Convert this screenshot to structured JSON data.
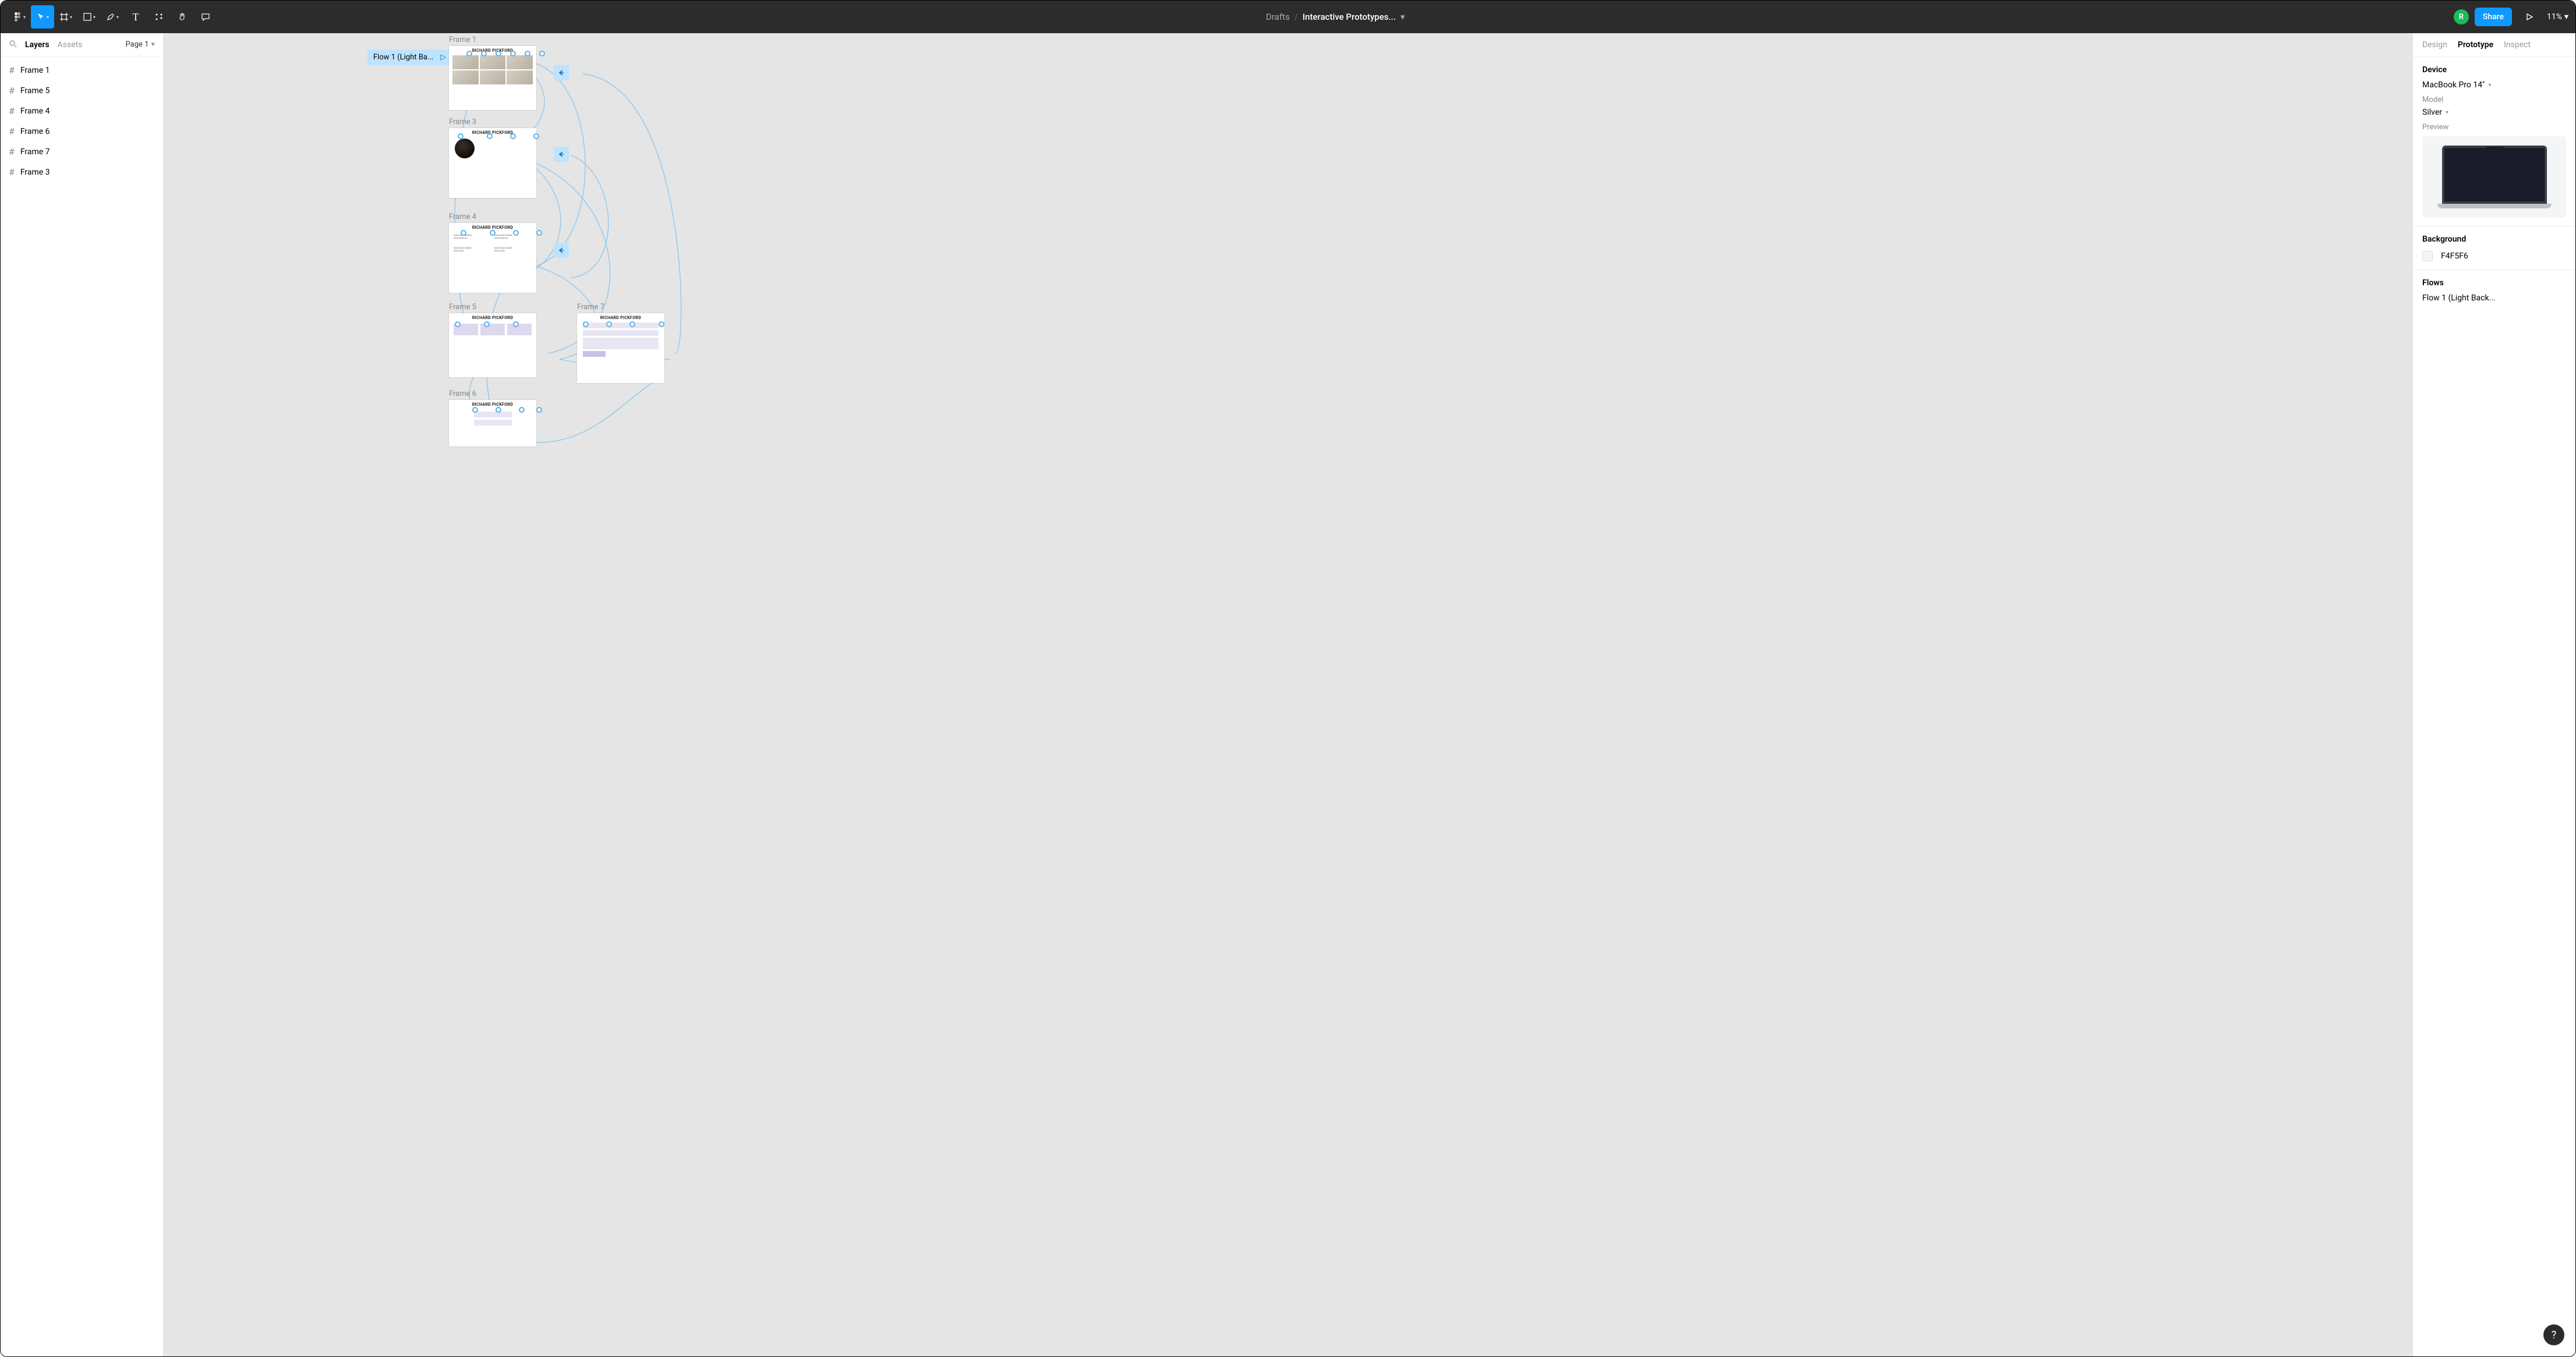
{
  "toolbar": {
    "breadcrumb_root": "Drafts",
    "title": "Interactive Prototypes...",
    "share_label": "Share",
    "zoom": "11%",
    "avatar_initial": "R"
  },
  "left": {
    "tab_layers": "Layers",
    "tab_assets": "Assets",
    "page": "Page 1",
    "layers": [
      "Frame 1",
      "Frame 5",
      "Frame 4",
      "Frame 6",
      "Frame 7",
      "Frame 3"
    ]
  },
  "canvas": {
    "flow_tag": "Flow 1 (Light Ba...",
    "frames": {
      "f1": {
        "label": "Frame 1",
        "heading": "RICHARD PICKFORD"
      },
      "f3": {
        "label": "Frame 3",
        "heading": "RICHARD PICKFORD"
      },
      "f4": {
        "label": "Frame 4",
        "heading": "RICHARD PICKFORD"
      },
      "f5": {
        "label": "Frame 5",
        "heading": "RICHARD PICKFORD"
      },
      "f7": {
        "label": "Frame 7",
        "heading": "RICHARD PICKFORD"
      },
      "f6": {
        "label": "Frame 6",
        "heading": "RICHARD PICKFORD"
      }
    }
  },
  "right": {
    "tab_design": "Design",
    "tab_prototype": "Prototype",
    "tab_inspect": "Inspect",
    "device_title": "Device",
    "device_value": "MacBook Pro 14\"",
    "model_label": "Model",
    "model_value": "Silver",
    "preview_label": "Preview",
    "background_title": "Background",
    "background_value": "F4F5F6",
    "flows_title": "Flows",
    "flow_item": "Flow 1 (Light Back..."
  },
  "help": "?"
}
